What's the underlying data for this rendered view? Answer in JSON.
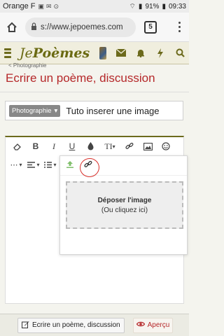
{
  "status_bar": {
    "carrier": "Orange F",
    "battery": "91%",
    "time": "09:33"
  },
  "browser": {
    "url": "s://www.jepoemes.com",
    "tab_count": "5"
  },
  "site": {
    "logo_prefix": "Je",
    "logo_suffix": "Poèmes",
    "breadcrumb": "< Photographie"
  },
  "page": {
    "title": "Ecrire un poème, discussion"
  },
  "form": {
    "category": "Photographie",
    "title_value": "Tuto inserer une image"
  },
  "editor": {
    "toolbar": {
      "bold": "B",
      "italic": "I",
      "underline": "U",
      "font_size": "TI"
    }
  },
  "image_popover": {
    "drop_title": "Déposer l'image",
    "drop_subtitle": "(Ou cliquez ici)"
  },
  "bottom_bar": {
    "post_label": "Ecrire un poème, discussion",
    "preview_label": "Aperçu"
  },
  "colors": {
    "accent": "#6c6a1c",
    "title_red": "#b5282a",
    "annotation_red": "#d8302b"
  }
}
